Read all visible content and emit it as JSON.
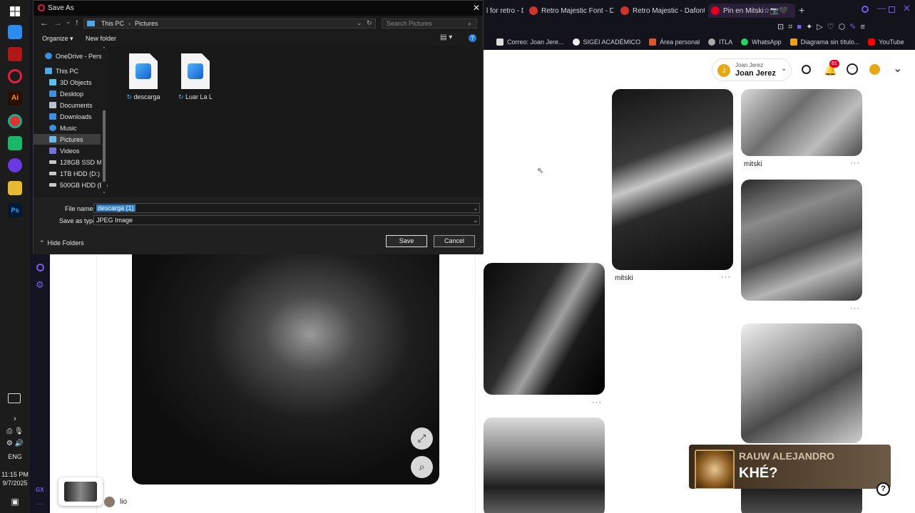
{
  "dialog": {
    "title": "Save As",
    "breadcrumb": [
      "This PC",
      "Pictures"
    ],
    "search_placeholder": "Search Pictures",
    "organize_label": "Organize ▾",
    "new_folder_label": "New folder",
    "nav_items": [
      {
        "label": "OneDrive - Persor",
        "icon": "cloud-icon",
        "color": "#3a8fe0"
      },
      {
        "label": "This PC",
        "icon": "pc-icon",
        "color": "#4fa7e8"
      },
      {
        "label": "3D Objects",
        "icon": "cube-icon",
        "color": "#5bc0eb"
      },
      {
        "label": "Desktop",
        "icon": "desktop-icon",
        "color": "#3f8fd8"
      },
      {
        "label": "Documents",
        "icon": "documents-icon",
        "color": "#b8c4d0"
      },
      {
        "label": "Downloads",
        "icon": "download-icon",
        "color": "#3a8fe0"
      },
      {
        "label": "Music",
        "icon": "music-icon",
        "color": "#3a8fe0"
      },
      {
        "label": "Pictures",
        "icon": "pictures-icon",
        "color": "#6fb8ea"
      },
      {
        "label": "Videos",
        "icon": "videos-icon",
        "color": "#7a6fd8"
      },
      {
        "label": "128GB SSD M.2 (",
        "icon": "drive-icon",
        "color": "#c8c8c8"
      },
      {
        "label": "1TB HDD (D:)",
        "icon": "drive-icon",
        "color": "#c8c8c8"
      },
      {
        "label": "500GB HDD (E:)",
        "icon": "drive-icon",
        "color": "#c8c8c8"
      }
    ],
    "files": [
      {
        "name": "descarga"
      },
      {
        "name": "Luar La L"
      }
    ],
    "file_name_label": "File name:",
    "file_name_value": "descarga (1)",
    "save_type_label": "Save as type:",
    "save_type_value": "JPEG Image",
    "hide_folders_label": "Hide Folders",
    "save_label": "Save",
    "cancel_label": "Cancel"
  },
  "taskbar": {
    "lang": "ENG",
    "time": "11:15 PM",
    "date": "9/7/2025"
  },
  "browser": {
    "tabs": [
      {
        "label": "l for retro - D",
        "color": "#777"
      },
      {
        "label": "Retro Majestic Font - Daf",
        "color": "#d0342c"
      },
      {
        "label": "Retro Majestic - Dafont F",
        "color": "#d0342c"
      },
      {
        "label": "Pin en Mitski☆📷🖤",
        "color": "#e60023"
      }
    ],
    "bookmarks": [
      {
        "label": "Correo: Joan Jere...",
        "color": "#2a6dd8"
      },
      {
        "label": "SIGEI ACADÉMICO",
        "color": "#ffffff"
      },
      {
        "label": "Área personal",
        "color": "#d85a2a"
      },
      {
        "label": "ITLA",
        "color": "#aaaaaa"
      },
      {
        "label": "WhatsApp",
        "color": "#25d366"
      },
      {
        "label": "Diagrama sin título...",
        "color": "#e8a020"
      },
      {
        "label": "YouTube",
        "color": "#ff0000"
      }
    ]
  },
  "pinterest": {
    "account_small": "Joan Jerez",
    "account_name": "Joan Jerez",
    "avatar_initial": "J",
    "notif_count": "61",
    "pin_captions": [
      "mitski",
      "mitski"
    ],
    "left_user": "lio",
    "player_artist": "RAUW ALEJANDRO",
    "player_title": "KHÉ?"
  }
}
